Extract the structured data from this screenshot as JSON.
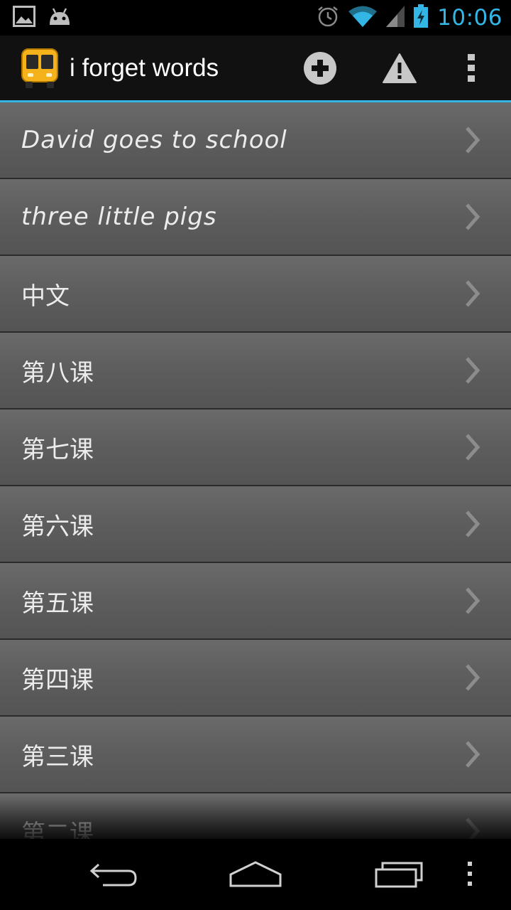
{
  "status_bar": {
    "time": "10:06",
    "left_icons": [
      "gallery-icon",
      "android-icon"
    ],
    "right_icons": [
      "alarm-icon",
      "wifi-icon",
      "signal-icon",
      "battery-charging-icon"
    ],
    "time_color": "#33b5e5"
  },
  "action_bar": {
    "title": "i forget words",
    "logo_icon": "bus-icon",
    "actions": [
      "add-icon",
      "warning-icon",
      "overflow-menu-icon"
    ],
    "accent_color": "#33b5e5"
  },
  "list": {
    "items": [
      {
        "label": "David goes to school"
      },
      {
        "label": "three little pigs"
      },
      {
        "label": "中文"
      },
      {
        "label": "第八课"
      },
      {
        "label": "第七课"
      },
      {
        "label": "第六课"
      },
      {
        "label": "第五课"
      },
      {
        "label": "第四课"
      },
      {
        "label": "第三课"
      },
      {
        "label": "第二课"
      }
    ]
  },
  "nav_bar": {
    "buttons": [
      "back-icon",
      "home-icon",
      "recents-icon",
      "menu-icon"
    ]
  }
}
